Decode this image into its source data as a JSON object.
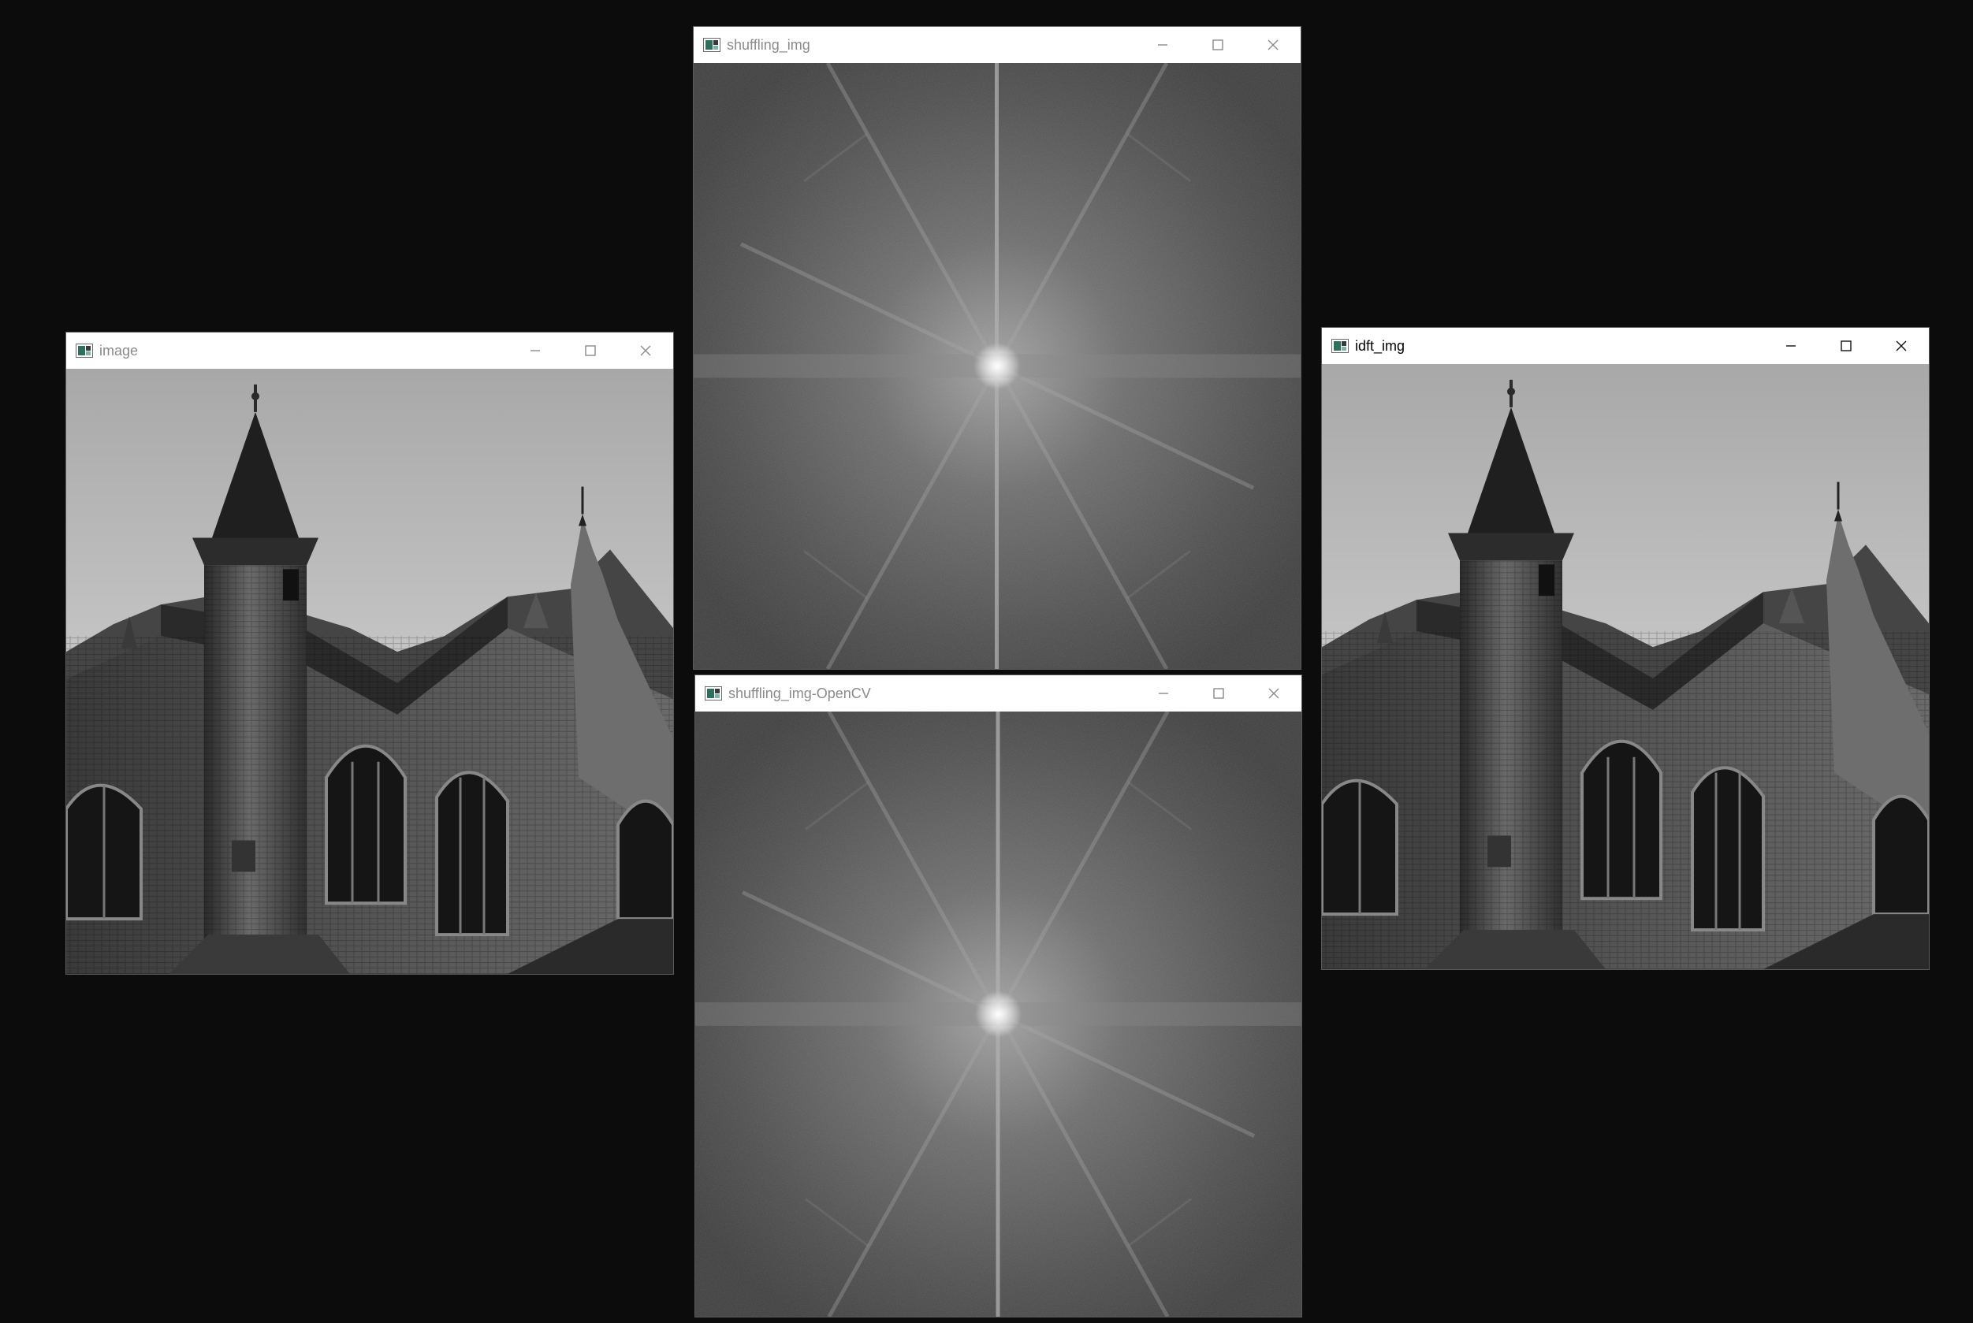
{
  "desktop": {
    "background": "#0c0c0c"
  },
  "windows": [
    {
      "id": "image",
      "title": "image",
      "active": false,
      "content": "grayscale photo of a gothic stone building with a conical spire tower against the sky"
    },
    {
      "id": "shuffling_img",
      "title": "shuffling_img",
      "active": false,
      "content": "Fourier magnitude spectrum (centered) with a bright central point and diagonal streaks"
    },
    {
      "id": "shuffling_img_opencv",
      "title": "shuffling_img-OpenCV",
      "active": false,
      "content": "Fourier magnitude spectrum computed with OpenCV"
    },
    {
      "id": "idft_img",
      "title": "idft_img",
      "active": true,
      "content": "inverse DFT reconstructed grayscale photo of the gothic building"
    }
  ],
  "controls": {
    "minimize": "minimize-icon",
    "maximize": "maximize-icon",
    "close": "close-icon"
  }
}
